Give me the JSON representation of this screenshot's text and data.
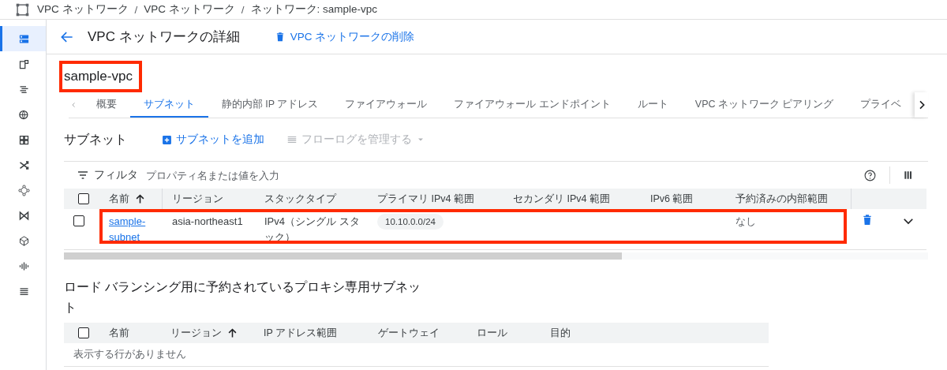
{
  "breadcrumbs": [
    "VPC ネットワーク",
    "VPC ネットワーク",
    "ネットワーク: sample-vpc"
  ],
  "breadcrumb_separator": "/",
  "sidebar": {
    "items": [
      {
        "selected": true
      },
      {
        "selected": false
      },
      {
        "selected": false
      },
      {
        "selected": false
      },
      {
        "selected": false
      },
      {
        "selected": false
      },
      {
        "selected": false
      },
      {
        "selected": false
      },
      {
        "selected": false
      },
      {
        "selected": false
      },
      {
        "selected": false
      }
    ]
  },
  "header": {
    "title": "VPC ネットワークの詳細",
    "delete_label": "VPC ネットワークの削除"
  },
  "network_name": {
    "text": "sample-vpc",
    "highlighted": true
  },
  "tabs": [
    {
      "label": "概要",
      "selected": false
    },
    {
      "label": "サブネット",
      "selected": true
    },
    {
      "label": "静的内部 IP アドレス",
      "selected": false
    },
    {
      "label": "ファイアウォール",
      "selected": false
    },
    {
      "label": "ファイアウォール エンドポイント",
      "selected": false
    },
    {
      "label": "ルート",
      "selected": false
    },
    {
      "label": "VPC ネットワーク ピアリング",
      "selected": false
    },
    {
      "label": "プライベ",
      "selected": false
    }
  ],
  "subnets": {
    "title": "サブネット",
    "add_label": "サブネットを追加",
    "flow_logs_label": "フローログを管理する",
    "flow_logs_disabled": true,
    "filter_label": "フィルタ",
    "filter_placeholder": "プロパティ名または値を入力",
    "select_all_checked": false,
    "columns": [
      {
        "label": "名前",
        "sorted": true
      },
      {
        "label": "リージョン",
        "sorted": false
      },
      {
        "label": "スタックタイプ",
        "sorted": false
      },
      {
        "label": "プライマリ IPv4 範囲",
        "sorted": false
      },
      {
        "label": "セカンダリ IPv4 範囲",
        "sorted": false
      },
      {
        "label": "IPv6 範囲",
        "sorted": false
      },
      {
        "label": "予約済みの内部範囲",
        "sorted": false
      }
    ],
    "rows": [
      {
        "name": "sample-subnet",
        "region": "asia-northeast1",
        "stack_type": "IPv4（シングル スタック）",
        "primary_ipv4": "10.10.0.0/24",
        "reserved": "なし",
        "checked": false,
        "highlighted": true
      }
    ]
  },
  "proxy_subnets": {
    "title": "ロード バランシング用に予約されているプロキシ専用サブネット",
    "select_all_checked": false,
    "columns": [
      {
        "label": "名前",
        "sorted": false
      },
      {
        "label": "リージョン",
        "sorted": true
      },
      {
        "label": "IP アドレス範囲",
        "sorted": false
      },
      {
        "label": "ゲートウェイ",
        "sorted": false
      },
      {
        "label": "ロール",
        "sorted": false
      },
      {
        "label": "目的",
        "sorted": false
      }
    ],
    "empty_text": "表示する行がありません"
  }
}
